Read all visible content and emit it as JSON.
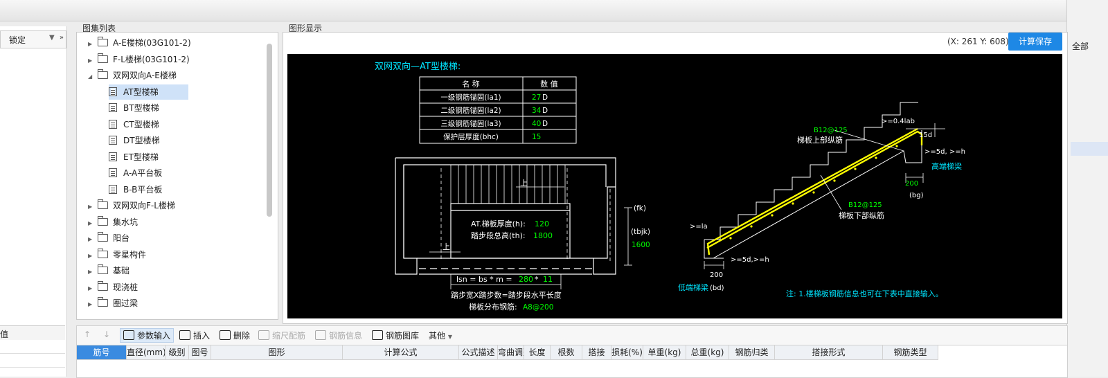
{
  "left": {
    "lock_label": "锁定",
    "val_label": "值"
  },
  "right": {
    "all_label": "全部"
  },
  "atlas": {
    "title": "图集列表",
    "items": [
      {
        "label": "A-E楼梯(03G101-2)",
        "kind": "folder",
        "expanded": false
      },
      {
        "label": "F-L楼梯(03G101-2)",
        "kind": "folder",
        "expanded": false
      },
      {
        "label": "双网双向A-E楼梯",
        "kind": "folder",
        "expanded": true
      },
      {
        "label": "AT型楼梯",
        "kind": "doc",
        "selected": true
      },
      {
        "label": "BT型楼梯",
        "kind": "doc"
      },
      {
        "label": "CT型楼梯",
        "kind": "doc"
      },
      {
        "label": "DT型楼梯",
        "kind": "doc"
      },
      {
        "label": "ET型楼梯",
        "kind": "doc"
      },
      {
        "label": "A-A平台板",
        "kind": "doc"
      },
      {
        "label": "B-B平台板",
        "kind": "doc"
      },
      {
        "label": "双网双向F-L楼梯",
        "kind": "folder",
        "expanded": false
      },
      {
        "label": "集水坑",
        "kind": "folder",
        "expanded": false
      },
      {
        "label": "阳台",
        "kind": "folder",
        "expanded": false
      },
      {
        "label": "零星构件",
        "kind": "folder",
        "expanded": false
      },
      {
        "label": "基础",
        "kind": "folder",
        "expanded": false
      },
      {
        "label": "现浇桩",
        "kind": "folder",
        "expanded": false
      },
      {
        "label": "圈过梁",
        "kind": "folder",
        "expanded": false
      }
    ]
  },
  "graphic": {
    "title": "图形显示",
    "coords": "(X: 261 Y: 608)",
    "calc_save": "计算保存",
    "drawing": {
      "heading": "双网双向—AT型楼梯:",
      "table_headers": [
        "名  称",
        "数  值"
      ],
      "table_rows": [
        {
          "name": "一级钢筋锚固(la1)",
          "value": "27",
          "unit": "D"
        },
        {
          "name": "二级钢筋锚固(la2)",
          "value": "34",
          "unit": "D"
        },
        {
          "name": "三级钢筋锚固(la3)",
          "value": "40",
          "unit": "D"
        },
        {
          "name": "保护层厚度(bhc)",
          "value": "15",
          "unit": ""
        }
      ],
      "thickness_label": "AT.梯板厚度(h):",
      "thickness_value": "120",
      "height_label": "踏步段总高(th):",
      "height_value": "1800",
      "fk": "(fk)",
      "tbjk": "(tbjk)",
      "tbjk_value": "1600",
      "up1": "上",
      "up2": "上",
      "lsn_label": "lsn = bs * m =",
      "lsn_bs": "280",
      "lsn_star": "*",
      "lsn_m": "11",
      "step_formula": "踏步宽X踏步数=踏步段水平长度",
      "dist_label": "梯板分布钢筋:",
      "dist_value": "A8@200",
      "top_rebar_value": "B12@125",
      "top_rebar_label": "梯板上部纵筋",
      "bottom_rebar_value": "B12@125",
      "bottom_rebar_label": "梯板下部纵筋",
      "ann_04lab": ">=0.4lab",
      "ann_15d": "15d",
      "ann_5d_h_right": ">=5d, >=h",
      "high_beam": "高端梯梁",
      "dim_200_right": "200",
      "bg": "(bg)",
      "ann_la": ">=la",
      "ann_5d_h_left": ">=5d,>=h",
      "dim_200_left": "200",
      "low_beam": "低端梯梁",
      "bd": "(bd)",
      "note": "注: 1.楼梯板钢筋信息也可在下表中直接输入。"
    }
  },
  "toolbar": {
    "up": "↑",
    "down": "↓",
    "param_input": "参数输入",
    "insert": "插入",
    "delete": "删除",
    "scale_rebar": "缩尺配筋",
    "rebar_info": "钢筋信息",
    "rebar_lib": "钢筋图库",
    "other": "其他"
  },
  "grid": {
    "headers": [
      "筋号",
      "直径(mm)",
      "级别",
      "图号",
      "图形",
      "计算公式",
      "公式描述",
      "弯曲调整",
      "长度",
      "根数",
      "搭接",
      "损耗(%)",
      "单重(kg)",
      "总重(kg)",
      "钢筋归类",
      "搭接形式",
      "钢筋类型"
    ]
  },
  "colors": {
    "accent": "#1e88e5",
    "cyan": "#00e5ff",
    "green": "#00ff00",
    "yellow": "#ffff00",
    "selection": "#cfe2f8"
  }
}
